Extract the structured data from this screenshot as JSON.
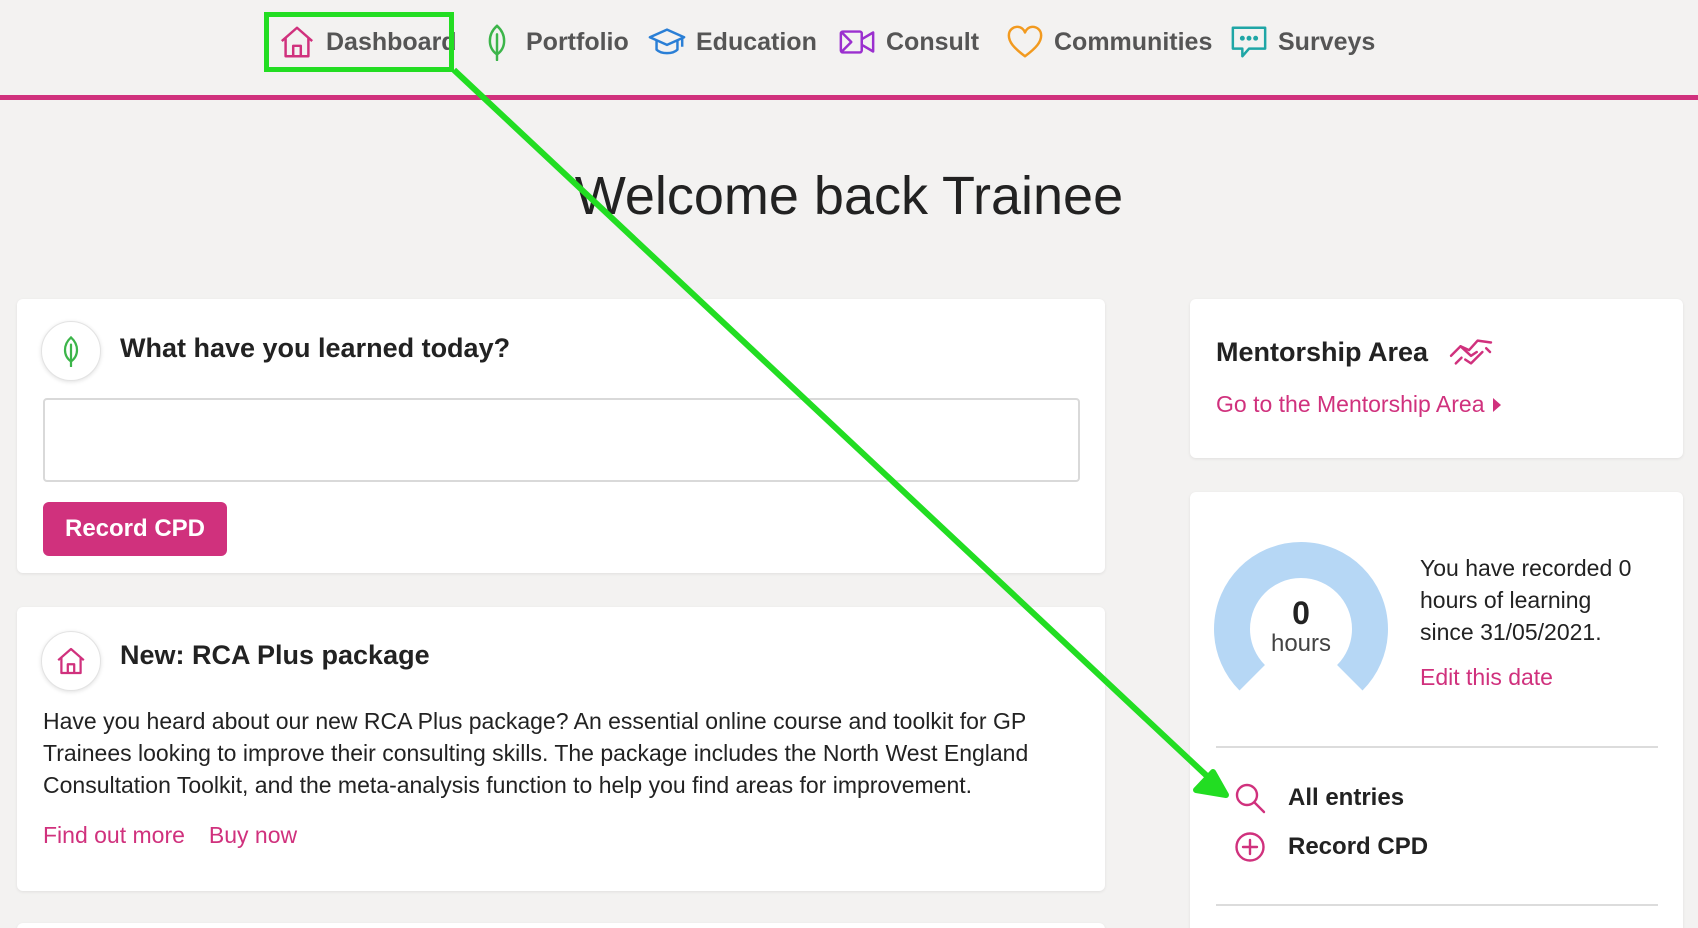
{
  "nav": {
    "items": [
      {
        "label": "Dashboard",
        "icon": "home-icon"
      },
      {
        "label": "Portfolio",
        "icon": "leaf-icon"
      },
      {
        "label": "Education",
        "icon": "graduation-cap-icon"
      },
      {
        "label": "Consult",
        "icon": "video-icon"
      },
      {
        "label": "Communities",
        "icon": "heart-icon"
      },
      {
        "label": "Surveys",
        "icon": "chat-bubble-icon"
      }
    ],
    "active": "Dashboard"
  },
  "welcome": "Welcome back Trainee",
  "learned_card": {
    "title": "What have you learned today?",
    "input_value": "",
    "input_placeholder": "",
    "button_label": "Record CPD"
  },
  "rca_card": {
    "title": "New: RCA Plus package",
    "body": "Have you heard about our new RCA Plus package? An essential online course and toolkit for GP Trainees looking to improve their consulting skills. The package includes the North West England Consultation Toolkit, and the meta-analysis function to help you find areas for improvement.",
    "link_more": "Find out more",
    "link_buy": "Buy now"
  },
  "mentorship": {
    "title": "Mentorship Area",
    "link": "Go to the Mentorship Area"
  },
  "hours_card": {
    "value": "0",
    "unit": "hours",
    "fill_fraction": 0,
    "text": "You have recorded 0 hours of learning since 31/05/2021.",
    "edit_link": "Edit this date",
    "action_all": "All entries",
    "action_record": "Record CPD"
  },
  "colors": {
    "accent": "#d0317d",
    "highlight": "#22dd22",
    "gauge": "#b6d7f5",
    "background": "#f3f2f1"
  }
}
